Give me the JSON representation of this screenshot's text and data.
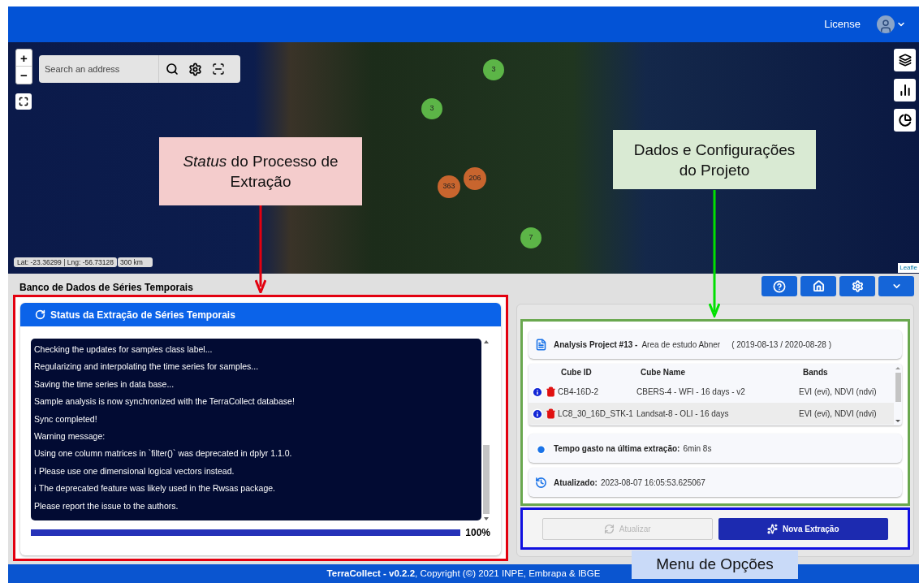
{
  "header": {
    "license": "License"
  },
  "map": {
    "search_placeholder": "Search an address",
    "zoom_in": "+",
    "zoom_out": "−",
    "coordinates": "Lat: -23.36299 | Lng: -56.73128",
    "scale": "300 km",
    "attribution": "Leafle",
    "clusters": [
      {
        "count": "3",
        "color": "#5cb547"
      },
      {
        "count": "3",
        "color": "#5cb547"
      },
      {
        "count": "206",
        "color": "#c8652e"
      },
      {
        "count": "363",
        "color": "#c8652e"
      },
      {
        "count": "7",
        "color": "#5cb547"
      }
    ]
  },
  "section_title": "Banco de Dados de Séries Temporais",
  "status_panel": {
    "title": "Status da Extração de Séries Temporais",
    "log": [
      "Checking the updates for samples class label...",
      "Regularizing and interpolating the time series for samples...",
      "Saving the time series in data base...",
      "Sample analysis is now synchronized with the TerraCollect database!",
      "Sync completed!",
      "Warning message:",
      "Using one column matrices in `filter()` was deprecated in dplyr 1.1.0.",
      "ℹ Please use one dimensional logical vectors instead.",
      "ℹ The deprecated feature was likely used in the Rwsas package.",
      "Please report the issue to the authors."
    ],
    "progress": {
      "level": 1,
      "reading": "100%"
    }
  },
  "project": {
    "label": "Analysis Project #13 -",
    "name": "Area de estudo Abner",
    "period": "( 2019-08-13 / 2020-08-28 )",
    "columns": [
      "Cube ID",
      "Cube Name",
      "Bands"
    ],
    "rows": [
      {
        "id": "CB4-16D-2",
        "name": "CBERS-4 - WFI - 16 days - v2",
        "bands": "EVI (evi), NDVI (ndvi)",
        "selected": false
      },
      {
        "id": "LC8_30_16D_STK-1",
        "name": "Landsat-8 - OLI - 16 days",
        "bands": "EVI (evi), NDVI (ndvi)",
        "selected": true
      }
    ],
    "elapsed": {
      "label": "Tempo gasto na última extração:",
      "value": "6min 8s"
    },
    "updated": {
      "label": "Atualizado:",
      "value": "2023-08-07 16:05:53.625067"
    }
  },
  "actions": [
    {
      "label": "Atualizar",
      "disabled": true
    },
    {
      "label": "Nova Extração",
      "disabled": false
    }
  ],
  "footer": "**TerraCollect - v0.2.2**, Copyright (©) 2021 INPE, Embrapa & IBGE",
  "annotations": [
    {
      "text": "*Status* do Processo de Extração",
      "color": "#f4cccc"
    },
    {
      "text": "Dados e Configurações do Projeto",
      "color": "#d9ead3"
    },
    {
      "text": "Menu de Opções",
      "color": "#c9daf8"
    }
  ]
}
